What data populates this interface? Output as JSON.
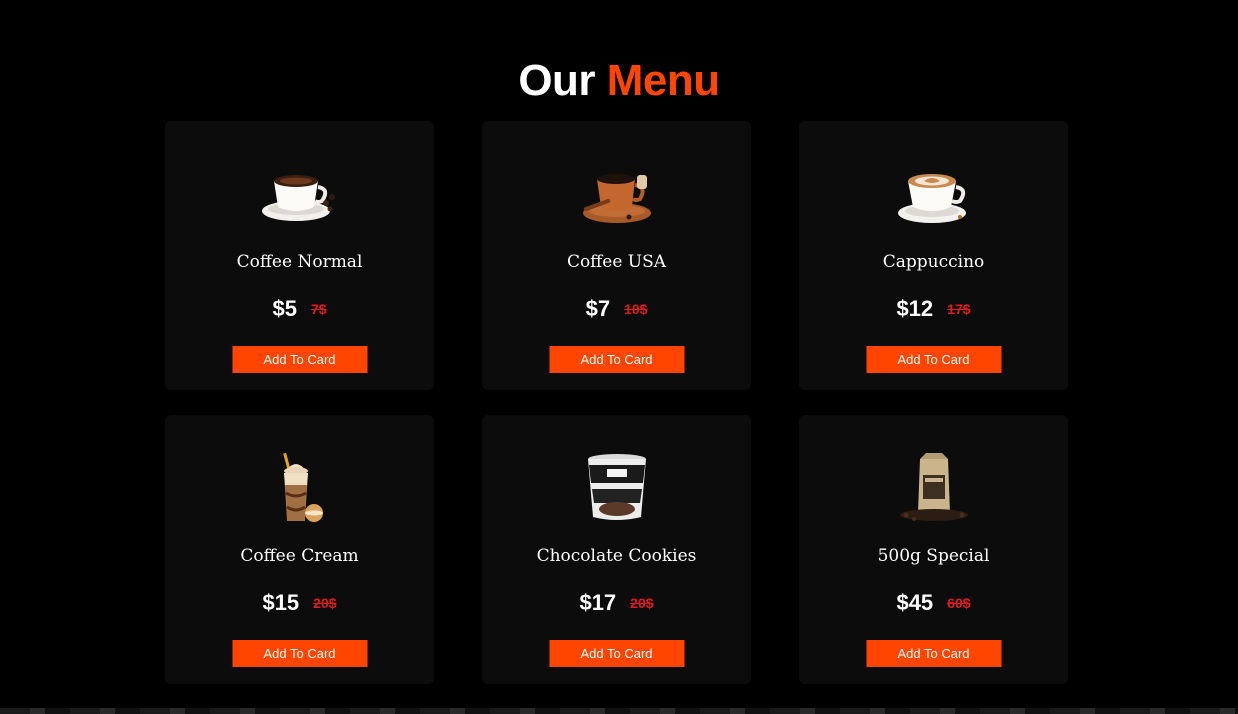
{
  "header": {
    "title_part1": "Our",
    "title_part2": "Menu",
    "accent_color": "#ff4500"
  },
  "menu": {
    "items": [
      {
        "name": "Coffee Normal",
        "price": "$5",
        "old_price": "7$",
        "button_label": "Add To Card",
        "icon": "coffee-cup-icon"
      },
      {
        "name": "Coffee USA",
        "price": "$7",
        "old_price": "10$",
        "button_label": "Add To Card",
        "icon": "clay-coffee-cup-icon"
      },
      {
        "name": "Cappuccino",
        "price": "$12",
        "old_price": "17$",
        "button_label": "Add To Card",
        "icon": "cappuccino-cup-icon"
      },
      {
        "name": "Coffee Cream",
        "price": "$15",
        "old_price": "20$",
        "button_label": "Add To Card",
        "icon": "iced-coffee-glass-icon"
      },
      {
        "name": "Chocolate Cookies",
        "price": "$17",
        "old_price": "20$",
        "button_label": "Add To Card",
        "icon": "ice-cream-tub-icon"
      },
      {
        "name": "500g Special",
        "price": "$45",
        "old_price": "60$",
        "button_label": "Add To Card",
        "icon": "coffee-bag-icon"
      }
    ]
  }
}
